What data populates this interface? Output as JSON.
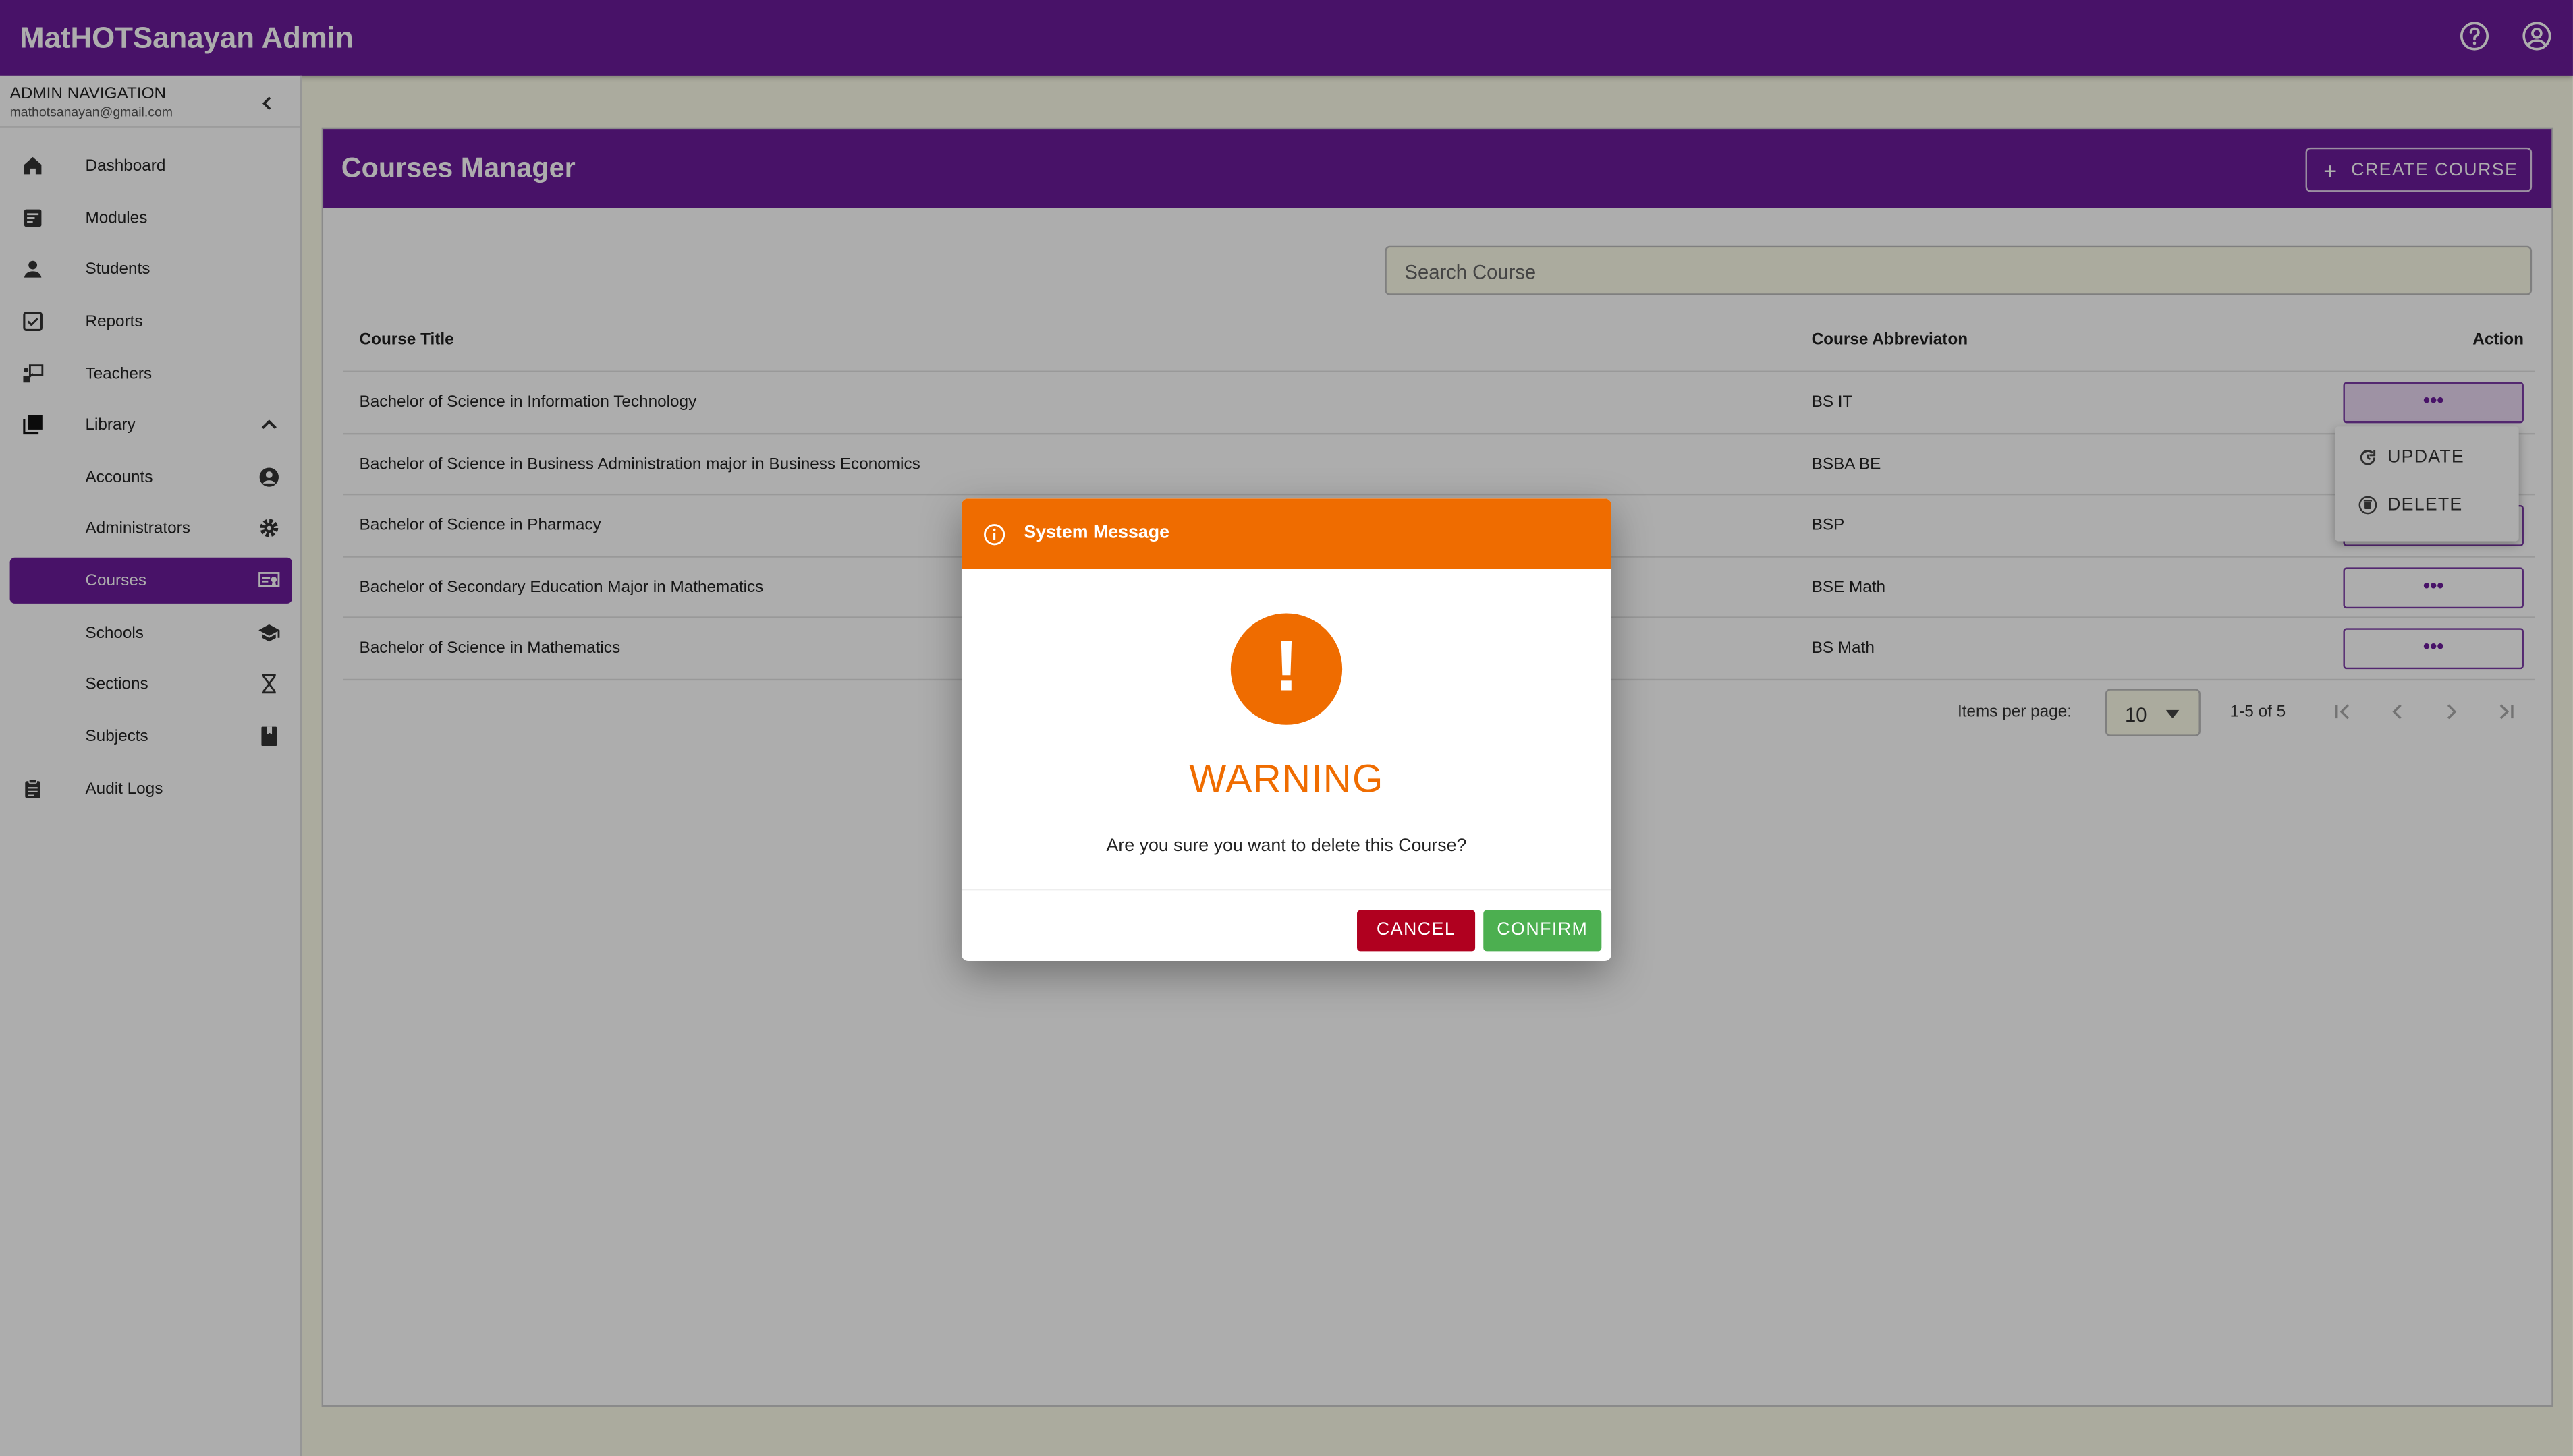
{
  "app": {
    "title": "MatHOTSanayan Admin"
  },
  "topbar": {
    "icons": [
      "help-icon",
      "account-circle-icon"
    ]
  },
  "sidebar": {
    "header_title": "ADMIN NAVIGATION",
    "header_email": "mathotsanayan@gmail.com",
    "items": [
      {
        "label": "Dashboard",
        "icon": "home-icon"
      },
      {
        "label": "Modules",
        "icon": "modules-icon"
      },
      {
        "label": "Students",
        "icon": "student-icon"
      },
      {
        "label": "Reports",
        "icon": "checkbox-icon"
      },
      {
        "label": "Teachers",
        "icon": "teacher-icon"
      },
      {
        "label": "Library",
        "icon": "library-icon"
      },
      {
        "label": "Accounts",
        "icon": "account-circle-icon"
      },
      {
        "label": "Administrators",
        "icon": "gear-icon"
      },
      {
        "label": "Courses",
        "icon": "courses-icon",
        "active": true
      },
      {
        "label": "Schools",
        "icon": "graduation-cap-icon"
      },
      {
        "label": "Sections",
        "icon": "sections-icon"
      },
      {
        "label": "Subjects",
        "icon": "book-icon"
      },
      {
        "label": "Audit Logs",
        "icon": "clipboard-icon"
      }
    ]
  },
  "main": {
    "title": "Courses Manager",
    "create_label": "CREATE COURSE",
    "search_placeholder": "Search Course",
    "columns": {
      "title": "Course Title",
      "abbr": "Course Abbreviaton",
      "action": "Action"
    },
    "rows": [
      {
        "title": "Bachelor of Science in Information Technology",
        "abbr": "BS IT"
      },
      {
        "title": "Bachelor of Science in Business Administration major in Business Economics",
        "abbr": "BSBA BE"
      },
      {
        "title": "Bachelor of Science in Pharmacy",
        "abbr": "BSP"
      },
      {
        "title": "Bachelor of Secondary Education Major in Mathematics",
        "abbr": "BSE Math"
      },
      {
        "title": "Bachelor of Science in Mathematics",
        "abbr": "BS Math"
      }
    ],
    "action_label": "•••",
    "menu": {
      "update": "UPDATE",
      "delete": "DELETE"
    },
    "pager": {
      "label": "Items per page:",
      "value": "10",
      "range": "1-5 of 5"
    }
  },
  "dialog": {
    "header": "System Message",
    "icon_symbol": "!",
    "title": "WARNING",
    "message": "Are you sure you want to delete this Course?",
    "cancel": "CANCEL",
    "confirm": "CONFIRM"
  },
  "colors": {
    "primary": "#6a1b9a",
    "warning": "#ef6c00",
    "cancel": "#b0001f",
    "confirm": "#4caf50"
  }
}
